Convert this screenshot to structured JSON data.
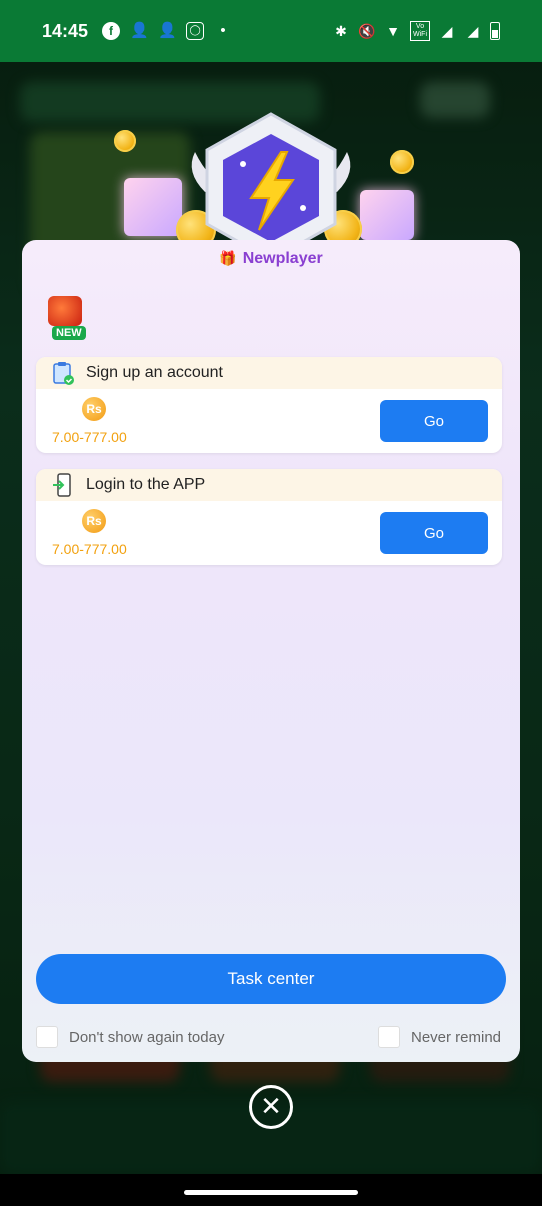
{
  "status_bar": {
    "time": "14:45",
    "left_icons": [
      "facebook-icon",
      "person-add-icon",
      "person-add-icon",
      "instagram-icon",
      "dot-icon"
    ],
    "right_icons": [
      "bluetooth-icon",
      "mute-icon",
      "wifi-icon",
      "volte-wifi-icon",
      "signal-icon",
      "signal-icon",
      "battery-icon"
    ],
    "volte_text": "Vo 2\nWiFi"
  },
  "modal": {
    "title": "Newplayer",
    "new_tag": "NEW",
    "tasks": [
      {
        "title": "Sign up an account",
        "currency": "Rs",
        "reward": "7.00-777.00",
        "button": "Go"
      },
      {
        "title": "Login to the APP",
        "currency": "Rs",
        "reward": "7.00-777.00",
        "button": "Go"
      }
    ],
    "task_center_button": "Task center",
    "dont_show_label": "Don't show again today",
    "never_remind_label": "Never remind"
  },
  "colors": {
    "status_bar": "#0a7a35",
    "accent_blue": "#1d7cf2",
    "title_purple": "#8a3fd1",
    "reward_orange": "#f2a10f"
  }
}
